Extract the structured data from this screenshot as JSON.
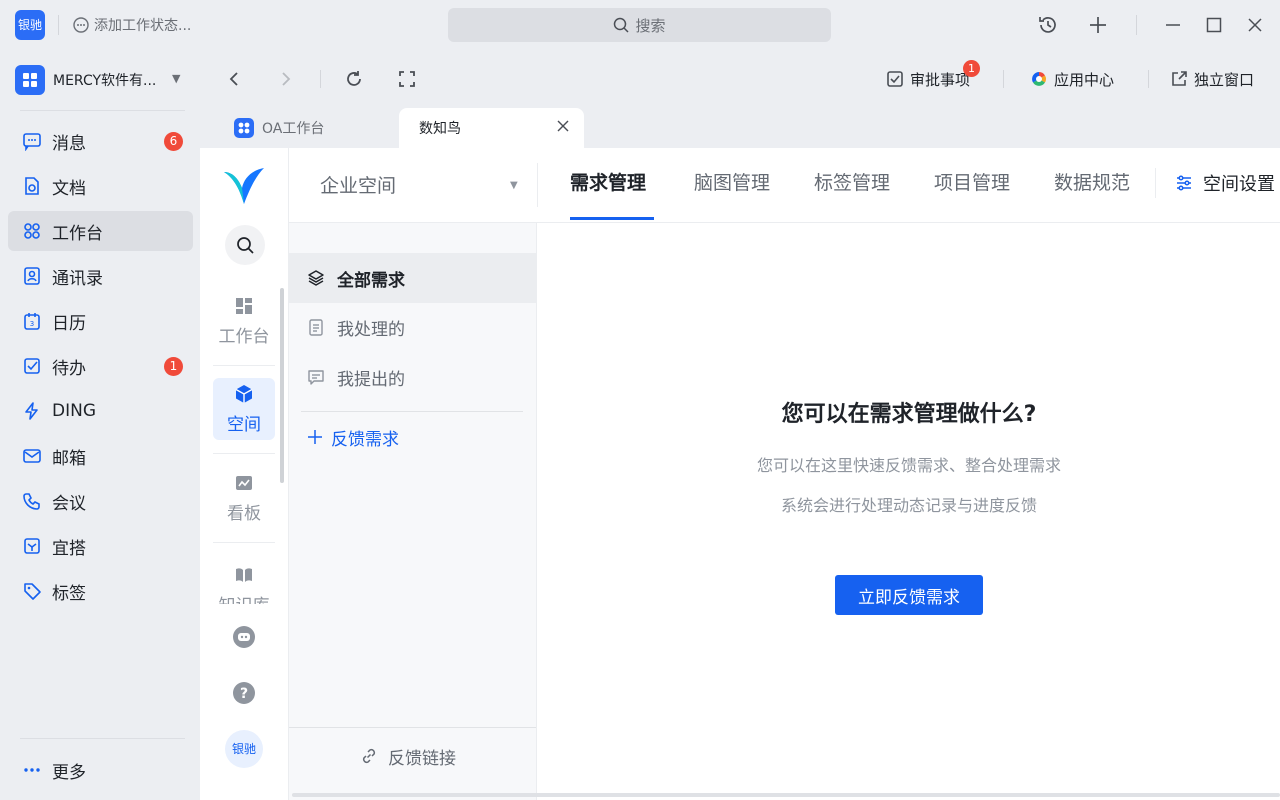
{
  "titlebar": {
    "avatar_text": "银驰",
    "status_text": "添加工作状态...",
    "search_placeholder": "搜索",
    "icons": [
      "history-icon",
      "plus-icon",
      "minimize-icon",
      "maximize-icon",
      "close-icon"
    ]
  },
  "org": {
    "name": "MERCY软件有..."
  },
  "nav": {
    "items": [
      {
        "label": "消息",
        "icon": "message-icon",
        "badge": "6"
      },
      {
        "label": "文档",
        "icon": "document-icon"
      },
      {
        "label": "工作台",
        "icon": "workbench-icon",
        "active": true
      },
      {
        "label": "通讯录",
        "icon": "contacts-icon"
      },
      {
        "label": "日历",
        "icon": "calendar-icon"
      },
      {
        "label": "待办",
        "icon": "todo-icon",
        "badge": "1"
      },
      {
        "label": "DING",
        "icon": "lightning-icon"
      },
      {
        "label": "邮箱",
        "icon": "mail-icon"
      },
      {
        "label": "会议",
        "icon": "meeting-icon"
      },
      {
        "label": "宜搭",
        "icon": "yida-icon"
      },
      {
        "label": "标签",
        "icon": "tag-icon"
      }
    ],
    "more_label": "更多"
  },
  "browser": {
    "approve_label": "审批事项",
    "approve_badge": "1",
    "app_center_label": "应用中心",
    "standalone_label": "独立窗口",
    "tabs": [
      {
        "label": "OA工作台"
      },
      {
        "label": "数知鸟",
        "active": true
      }
    ]
  },
  "app": {
    "sidebar": {
      "items": [
        {
          "label": "工作台",
          "icon": "dashboard-icon"
        },
        {
          "label": "空间",
          "icon": "cube-icon",
          "active": true
        },
        {
          "label": "看板",
          "icon": "chart-icon"
        },
        {
          "label": "知识库",
          "icon": "book-icon"
        }
      ],
      "avatar_text": "银驰"
    },
    "header": {
      "space_select": "企业空间",
      "tabs": [
        "需求管理",
        "脑图管理",
        "标签管理",
        "项目管理",
        "数据规范"
      ],
      "active_tab": "需求管理",
      "settings_label": "空间设置"
    },
    "req_nav": {
      "items": [
        {
          "label": "全部需求",
          "icon": "layers-icon",
          "active": true
        },
        {
          "label": "我处理的",
          "icon": "clipboard-icon"
        },
        {
          "label": "我提出的",
          "icon": "comment-icon"
        }
      ],
      "feedback_label": "反馈需求",
      "link_label": "反馈链接"
    },
    "empty": {
      "title": "您可以在需求管理做什么?",
      "line1": "您可以在这里快速反馈需求、整合处理需求",
      "line2": "系统会进行处理动态记录与进度反馈",
      "button": "立即反馈需求"
    }
  },
  "colors": {
    "accent": "#1661f0",
    "badge": "#f04a3a",
    "brand": "#2b6df6"
  }
}
